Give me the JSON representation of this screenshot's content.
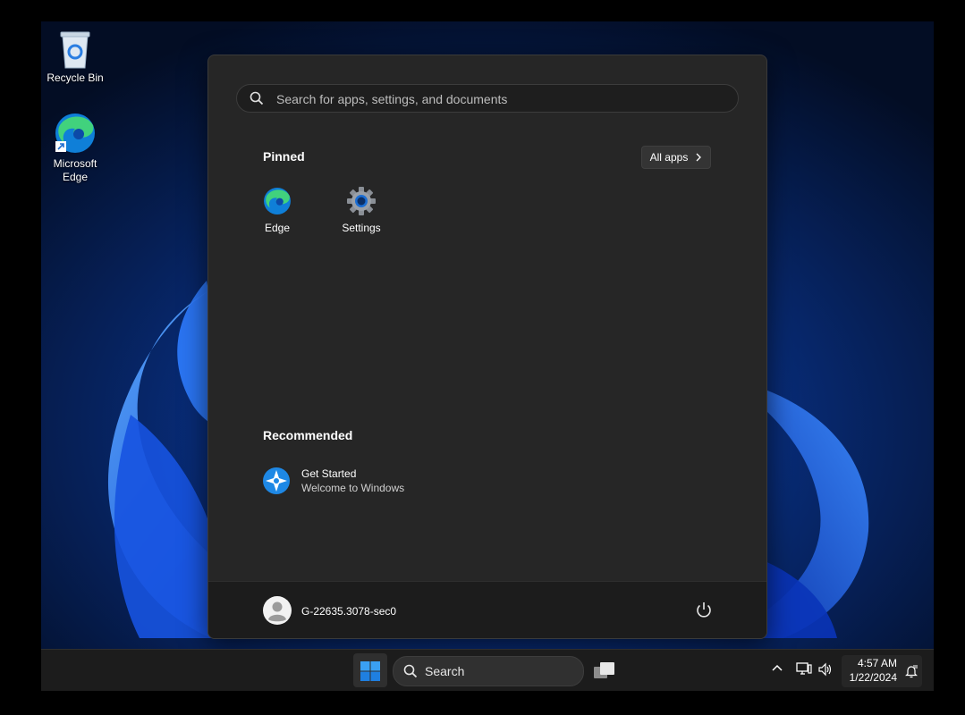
{
  "desktop": {
    "icons": [
      {
        "label": "Recycle Bin",
        "icon": "recycle-bin-icon"
      },
      {
        "label": "Microsoft Edge",
        "icon": "edge-icon"
      }
    ]
  },
  "start_menu": {
    "search_placeholder": "Search for apps, settings, and documents",
    "pinned_title": "Pinned",
    "all_apps_label": "All apps",
    "pinned": [
      {
        "label": "Edge",
        "icon": "edge-icon"
      },
      {
        "label": "Settings",
        "icon": "settings-gear-icon"
      }
    ],
    "recommended_title": "Recommended",
    "recommended": [
      {
        "title": "Get Started",
        "subtitle": "Welcome to Windows",
        "icon": "get-started-icon"
      }
    ],
    "user_name": "G-22635.3078-sec0",
    "power_icon": "power-icon"
  },
  "taskbar": {
    "search_label": "Search",
    "time": "4:57 AM",
    "date": "1/22/2024",
    "tray_icons": [
      "chevron-up-icon",
      "network-icon",
      "volume-icon",
      "notification-icon"
    ]
  },
  "colors": {
    "menu_bg": "#262626",
    "taskbar_bg": "#1c1c1c",
    "accent": "#0078d4",
    "wallpaper": "#061a3f"
  }
}
